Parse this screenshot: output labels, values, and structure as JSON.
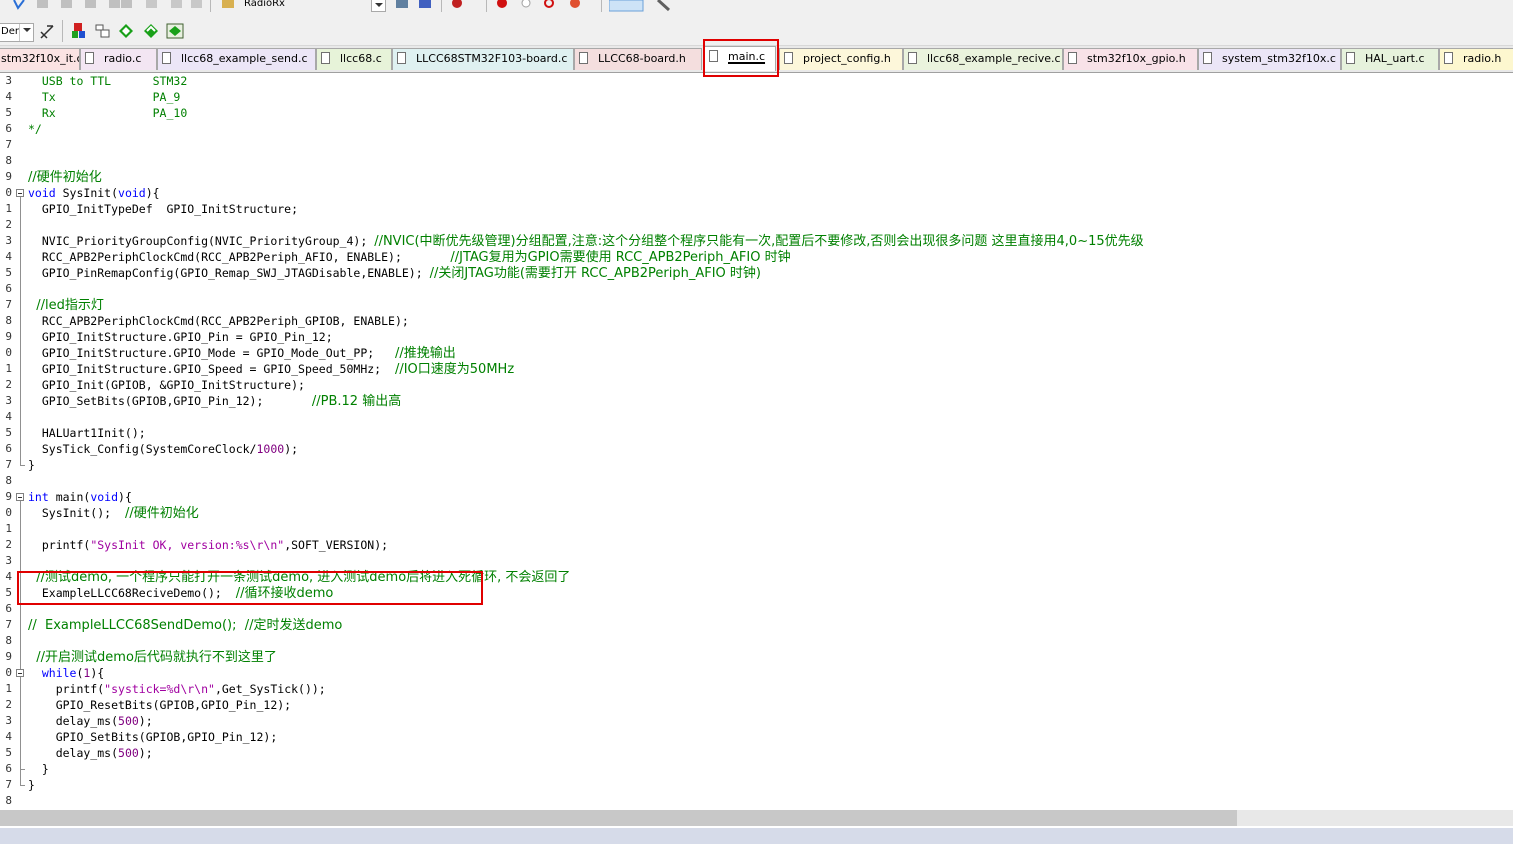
{
  "toolbar": {
    "target_value": "RadioRx",
    "open_combo_value": "Den"
  },
  "tabs": [
    {
      "label": "stm32f10x_it.c",
      "icon": "c-file-icon"
    },
    {
      "label": "radio.c",
      "icon": "c-file-icon"
    },
    {
      "label": "llcc68_example_send.c",
      "icon": "c-file-icon"
    },
    {
      "label": "llcc68.c",
      "icon": "c-file-icon"
    },
    {
      "label": "LLCC68STM32F103-board.c",
      "icon": "c-file-icon"
    },
    {
      "label": "LLCC68-board.h",
      "icon": "h-file-icon"
    },
    {
      "label": "main.c",
      "icon": "c-file-icon",
      "active": true
    },
    {
      "label": "project_config.h",
      "icon": "h-file-icon"
    },
    {
      "label": "llcc68_example_recive.c",
      "icon": "c-file-icon"
    },
    {
      "label": "stm32f10x_gpio.h",
      "icon": "h-file-icon"
    },
    {
      "label": "system_stm32f10x.c",
      "icon": "c-file-icon"
    },
    {
      "label": "HAL_uart.c",
      "icon": "c-file-icon"
    },
    {
      "label": "radio.h",
      "icon": "h-file-icon"
    }
  ],
  "colors": {
    "keyword": "#0000ff",
    "comment": "#008000",
    "string": "#a000a0",
    "number": "#800080",
    "highlight": "#e00000"
  },
  "code": {
    "line_numbers": [
      "3",
      "4",
      "5",
      "6",
      "7",
      "8",
      "9",
      "0",
      "1",
      "2",
      "3",
      "4",
      "5",
      "6",
      "7",
      "8",
      "9",
      "0",
      "1",
      "2",
      "3",
      "4",
      "5",
      "6",
      "7",
      "8",
      "9",
      "0",
      "1",
      "2",
      "3",
      "4",
      "5",
      "6",
      "7",
      "8",
      "9",
      "0",
      "1",
      "2",
      "3",
      "4",
      "5",
      "6",
      "7",
      "8"
    ],
    "lines": [
      {
        "t": "USB to TTL      STM32",
        "indent": "  ",
        "cls": "cm"
      },
      {
        "t": "Tx              PA_9",
        "indent": "  ",
        "cls": "cm"
      },
      {
        "t": "Rx              PA_10",
        "indent": "  ",
        "cls": "cm"
      },
      {
        "t": "*/",
        "cls": "cm"
      },
      {
        "t": ""
      },
      {
        "t": ""
      },
      {
        "t": "//硬件初始化",
        "cls": "cm"
      },
      {
        "segs": [
          [
            "void",
            "kw"
          ],
          [
            " SysInit",
            ""
          ],
          [
            "(",
            "",
            ""
          ],
          [
            "void",
            "kw"
          ],
          [
            "){",
            ""
          ]
        ]
      },
      {
        "t": "  GPIO_InitTypeDef  GPIO_InitStructure;"
      },
      {
        "t": ""
      },
      {
        "segs": [
          [
            "  NVIC_PriorityGroupConfig(NVIC_PriorityGroup_4); ",
            ""
          ],
          [
            "//NVIC(中断优先级管理)分组配置,注意:这个分组整个程序只能有一次,配置后不要修改,否则会出现很多问题 这里直接用4,0~15优先级",
            "cm"
          ]
        ]
      },
      {
        "segs": [
          [
            "  RCC_APB2PeriphClockCmd(RCC_APB2Periph_AFIO, ENABLE);       ",
            ""
          ],
          [
            "//JTAG复用为GPIO需要使用 RCC_APB2Periph_AFIO 时钟",
            "cm"
          ]
        ]
      },
      {
        "segs": [
          [
            "  GPIO_PinRemapConfig(GPIO_Remap_SWJ_JTAGDisable,ENABLE); ",
            ""
          ],
          [
            "//关闭JTAG功能(需要打开 RCC_APB2Periph_AFIO 时钟)",
            "cm"
          ]
        ]
      },
      {
        "t": ""
      },
      {
        "t": "  //led指示灯",
        "cls": "cm"
      },
      {
        "t": "  RCC_APB2PeriphClockCmd(RCC_APB2Periph_GPIOB, ENABLE);"
      },
      {
        "t": "  GPIO_InitStructure.GPIO_Pin = GPIO_Pin_12;"
      },
      {
        "segs": [
          [
            "  GPIO_InitStructure.GPIO_Mode = GPIO_Mode_Out_PP;   ",
            ""
          ],
          [
            "//推挽输出",
            "cm"
          ]
        ]
      },
      {
        "segs": [
          [
            "  GPIO_InitStructure.GPIO_Speed = GPIO_Speed_50MHz;  ",
            ""
          ],
          [
            "//IO口速度为50MHz",
            "cm"
          ]
        ]
      },
      {
        "t": "  GPIO_Init(GPIOB, &GPIO_InitStructure);"
      },
      {
        "segs": [
          [
            "  GPIO_SetBits(GPIOB,GPIO_Pin_12);       ",
            ""
          ],
          [
            "//PB.12 输出高",
            "cm"
          ]
        ]
      },
      {
        "t": ""
      },
      {
        "t": "  HALUart1Init();"
      },
      {
        "segs": [
          [
            "  SysTick_Config(SystemCoreClock/",
            ""
          ],
          [
            "1000",
            "num"
          ],
          [
            ");",
            ""
          ]
        ]
      },
      {
        "t": "}"
      },
      {
        "t": ""
      },
      {
        "segs": [
          [
            "int",
            "kw"
          ],
          [
            " main(",
            ""
          ],
          [
            "void",
            "kw"
          ],
          [
            "){",
            ""
          ]
        ]
      },
      {
        "segs": [
          [
            "  SysInit();  ",
            ""
          ],
          [
            "//硬件初始化",
            "cm"
          ]
        ]
      },
      {
        "t": ""
      },
      {
        "segs": [
          [
            "  printf(",
            ""
          ],
          [
            "\"SysInit OK, version:%s\\r\\n\"",
            "str"
          ],
          [
            ",SOFT_VERSION);",
            ""
          ]
        ]
      },
      {
        "t": ""
      },
      {
        "t": "  //测试demo, 一个程序只能打开一条测试demo, 进入测试demo后将进入死循环, 不会返回了",
        "cls": "cm"
      },
      {
        "segs": [
          [
            "  ExampleLLCC68ReciveDemo();  ",
            ""
          ],
          [
            "//循环接收demo",
            "cm"
          ]
        ]
      },
      {
        "t": ""
      },
      {
        "t": "//  ExampleLLCC68SendDemo();  //定时发送demo",
        "cls": "cm"
      },
      {
        "t": ""
      },
      {
        "t": "  //开启测试demo后代码就执行不到这里了",
        "cls": "cm"
      },
      {
        "segs": [
          [
            "  ",
            ""
          ],
          [
            "while",
            "kw"
          ],
          [
            "(",
            ""
          ],
          [
            "1",
            "num"
          ],
          [
            "){",
            ""
          ]
        ]
      },
      {
        "segs": [
          [
            "    printf(",
            ""
          ],
          [
            "\"systick=%d\\r\\n\"",
            "str"
          ],
          [
            ",Get_SysTick());",
            ""
          ]
        ]
      },
      {
        "t": "    GPIO_ResetBits(GPIOB,GPIO_Pin_12);"
      },
      {
        "segs": [
          [
            "    delay_ms(",
            ""
          ],
          [
            "500",
            "num"
          ],
          [
            ");",
            ""
          ]
        ]
      },
      {
        "t": "    GPIO_SetBits(GPIOB,GPIO_Pin_12);"
      },
      {
        "segs": [
          [
            "    delay_ms(",
            ""
          ],
          [
            "500",
            "num"
          ],
          [
            ");",
            ""
          ]
        ]
      },
      {
        "t": "  }"
      },
      {
        "t": "}"
      },
      {
        "t": ""
      }
    ]
  }
}
